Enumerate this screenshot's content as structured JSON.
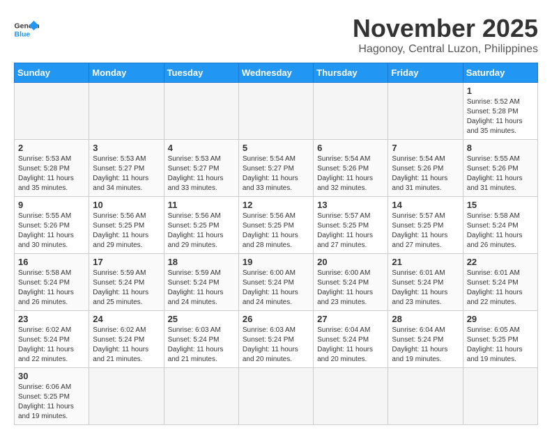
{
  "header": {
    "logo_general": "General",
    "logo_blue": "Blue",
    "month_title": "November 2025",
    "location": "Hagonoy, Central Luzon, Philippines"
  },
  "weekdays": [
    "Sunday",
    "Monday",
    "Tuesday",
    "Wednesday",
    "Thursday",
    "Friday",
    "Saturday"
  ],
  "weeks": [
    [
      {
        "day": "",
        "empty": true
      },
      {
        "day": "",
        "empty": true
      },
      {
        "day": "",
        "empty": true
      },
      {
        "day": "",
        "empty": true
      },
      {
        "day": "",
        "empty": true
      },
      {
        "day": "",
        "empty": true
      },
      {
        "day": "1",
        "sunrise": "5:52 AM",
        "sunset": "5:28 PM",
        "daylight": "11 hours and 35 minutes."
      }
    ],
    [
      {
        "day": "2",
        "sunrise": "5:53 AM",
        "sunset": "5:28 PM",
        "daylight": "11 hours and 35 minutes."
      },
      {
        "day": "3",
        "sunrise": "5:53 AM",
        "sunset": "5:27 PM",
        "daylight": "11 hours and 34 minutes."
      },
      {
        "day": "4",
        "sunrise": "5:53 AM",
        "sunset": "5:27 PM",
        "daylight": "11 hours and 33 minutes."
      },
      {
        "day": "5",
        "sunrise": "5:54 AM",
        "sunset": "5:27 PM",
        "daylight": "11 hours and 33 minutes."
      },
      {
        "day": "6",
        "sunrise": "5:54 AM",
        "sunset": "5:26 PM",
        "daylight": "11 hours and 32 minutes."
      },
      {
        "day": "7",
        "sunrise": "5:54 AM",
        "sunset": "5:26 PM",
        "daylight": "11 hours and 31 minutes."
      },
      {
        "day": "8",
        "sunrise": "5:55 AM",
        "sunset": "5:26 PM",
        "daylight": "11 hours and 31 minutes."
      }
    ],
    [
      {
        "day": "9",
        "sunrise": "5:55 AM",
        "sunset": "5:26 PM",
        "daylight": "11 hours and 30 minutes."
      },
      {
        "day": "10",
        "sunrise": "5:56 AM",
        "sunset": "5:25 PM",
        "daylight": "11 hours and 29 minutes."
      },
      {
        "day": "11",
        "sunrise": "5:56 AM",
        "sunset": "5:25 PM",
        "daylight": "11 hours and 29 minutes."
      },
      {
        "day": "12",
        "sunrise": "5:56 AM",
        "sunset": "5:25 PM",
        "daylight": "11 hours and 28 minutes."
      },
      {
        "day": "13",
        "sunrise": "5:57 AM",
        "sunset": "5:25 PM",
        "daylight": "11 hours and 27 minutes."
      },
      {
        "day": "14",
        "sunrise": "5:57 AM",
        "sunset": "5:25 PM",
        "daylight": "11 hours and 27 minutes."
      },
      {
        "day": "15",
        "sunrise": "5:58 AM",
        "sunset": "5:24 PM",
        "daylight": "11 hours and 26 minutes."
      }
    ],
    [
      {
        "day": "16",
        "sunrise": "5:58 AM",
        "sunset": "5:24 PM",
        "daylight": "11 hours and 26 minutes."
      },
      {
        "day": "17",
        "sunrise": "5:59 AM",
        "sunset": "5:24 PM",
        "daylight": "11 hours and 25 minutes."
      },
      {
        "day": "18",
        "sunrise": "5:59 AM",
        "sunset": "5:24 PM",
        "daylight": "11 hours and 24 minutes."
      },
      {
        "day": "19",
        "sunrise": "6:00 AM",
        "sunset": "5:24 PM",
        "daylight": "11 hours and 24 minutes."
      },
      {
        "day": "20",
        "sunrise": "6:00 AM",
        "sunset": "5:24 PM",
        "daylight": "11 hours and 23 minutes."
      },
      {
        "day": "21",
        "sunrise": "6:01 AM",
        "sunset": "5:24 PM",
        "daylight": "11 hours and 23 minutes."
      },
      {
        "day": "22",
        "sunrise": "6:01 AM",
        "sunset": "5:24 PM",
        "daylight": "11 hours and 22 minutes."
      }
    ],
    [
      {
        "day": "23",
        "sunrise": "6:02 AM",
        "sunset": "5:24 PM",
        "daylight": "11 hours and 22 minutes."
      },
      {
        "day": "24",
        "sunrise": "6:02 AM",
        "sunset": "5:24 PM",
        "daylight": "11 hours and 21 minutes."
      },
      {
        "day": "25",
        "sunrise": "6:03 AM",
        "sunset": "5:24 PM",
        "daylight": "11 hours and 21 minutes."
      },
      {
        "day": "26",
        "sunrise": "6:03 AM",
        "sunset": "5:24 PM",
        "daylight": "11 hours and 20 minutes."
      },
      {
        "day": "27",
        "sunrise": "6:04 AM",
        "sunset": "5:24 PM",
        "daylight": "11 hours and 20 minutes."
      },
      {
        "day": "28",
        "sunrise": "6:04 AM",
        "sunset": "5:24 PM",
        "daylight": "11 hours and 19 minutes."
      },
      {
        "day": "29",
        "sunrise": "6:05 AM",
        "sunset": "5:25 PM",
        "daylight": "11 hours and 19 minutes."
      }
    ],
    [
      {
        "day": "30",
        "sunrise": "6:06 AM",
        "sunset": "5:25 PM",
        "daylight": "11 hours and 19 minutes."
      },
      {
        "day": "",
        "empty": true
      },
      {
        "day": "",
        "empty": true
      },
      {
        "day": "",
        "empty": true
      },
      {
        "day": "",
        "empty": true
      },
      {
        "day": "",
        "empty": true
      },
      {
        "day": "",
        "empty": true
      }
    ]
  ]
}
